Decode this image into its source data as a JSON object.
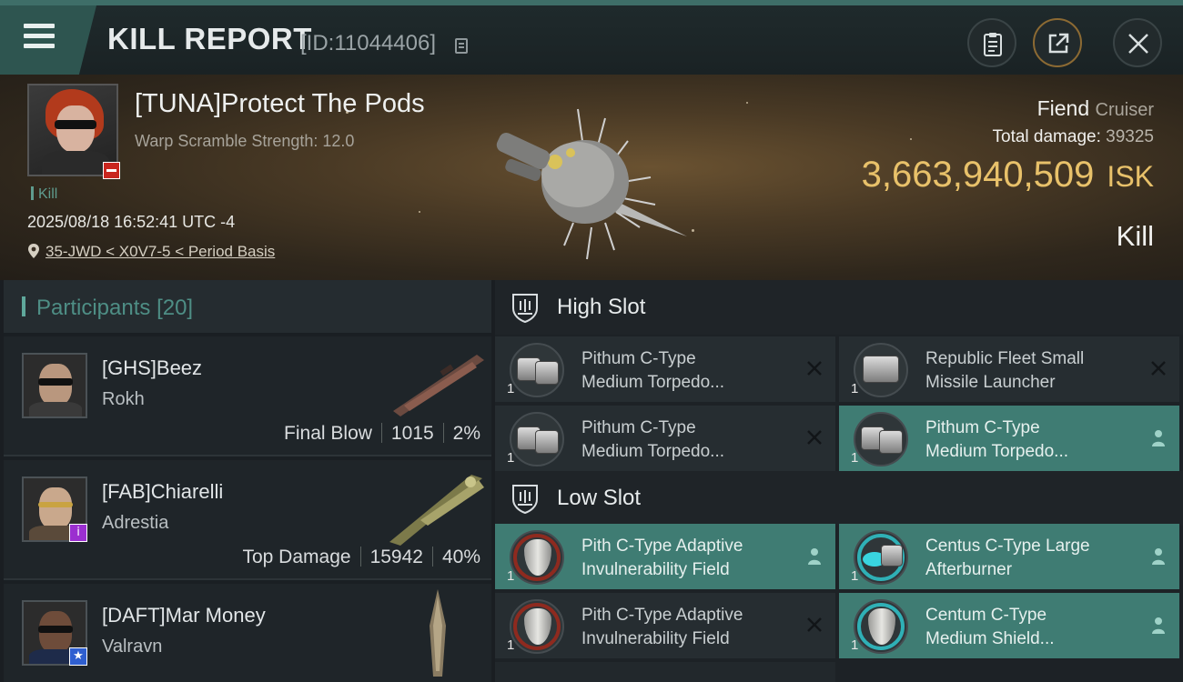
{
  "header": {
    "title": "KILL REPORT",
    "report_id": "[ID:11044406]"
  },
  "victim": {
    "name": "[TUNA]Protect The Pods",
    "subtitle": "Warp Scramble Strength: 12.0",
    "tag": "Kill",
    "datetime": "2025/08/18 16:52:41 UTC -4",
    "location": "35-JWD < X0V7-5 < Period Basis",
    "ship_name": "Fiend",
    "ship_class": "Cruiser",
    "total_damage_label": "Total damage:",
    "total_damage": "39325",
    "isk_value": "3,663,940,509",
    "isk_unit": "ISK",
    "result": "Kill"
  },
  "participants": {
    "title": "Participants",
    "count": "[20]",
    "items": [
      {
        "name": "[GHS]Beez",
        "ship": "Rokh",
        "role": "Final Blow",
        "damage": "1015",
        "percent": "2%"
      },
      {
        "name": "[FAB]Chiarelli",
        "ship": "Adrestia",
        "role": "Top Damage",
        "damage": "15942",
        "percent": "40%",
        "badge": "i",
        "badge_color": "#9b2fd0"
      },
      {
        "name": "[DAFT]Mar Money",
        "ship": "Valravn",
        "badge": "★",
        "badge_color": "#2f5fd0"
      }
    ]
  },
  "slots": {
    "high": {
      "title": "High Slot",
      "items": [
        {
          "qty": "1",
          "line1": "Pithum C-Type",
          "line2": "Medium Torpedo...",
          "status": "destroyed",
          "highlight": false
        },
        {
          "qty": "1",
          "line1": "Republic Fleet Small",
          "line2": "Missile Launcher",
          "status": "destroyed",
          "highlight": false
        },
        {
          "qty": "1",
          "line1": "Pithum C-Type",
          "line2": "Medium Torpedo...",
          "status": "destroyed",
          "highlight": false
        },
        {
          "qty": "1",
          "line1": "Pithum C-Type",
          "line2": "Medium Torpedo...",
          "status": "dropped",
          "highlight": true
        }
      ]
    },
    "low": {
      "title": "Low Slot",
      "items": [
        {
          "qty": "1",
          "line1": "Pith C-Type Adaptive",
          "line2": "Invulnerability Field",
          "status": "dropped",
          "highlight": true
        },
        {
          "qty": "1",
          "line1": "Centus C-Type Large",
          "line2": "Afterburner",
          "status": "dropped",
          "highlight": true
        },
        {
          "qty": "1",
          "line1": "Pith C-Type Adaptive",
          "line2": "Invulnerability Field",
          "status": "destroyed",
          "highlight": false
        },
        {
          "qty": "1",
          "line1": "Centum C-Type",
          "line2": "Medium Shield...",
          "status": "dropped",
          "highlight": true
        }
      ]
    }
  },
  "colors": {
    "accent": "#3f7c73",
    "isk": "#e8c16a",
    "teal_text": "#4e8e85"
  }
}
